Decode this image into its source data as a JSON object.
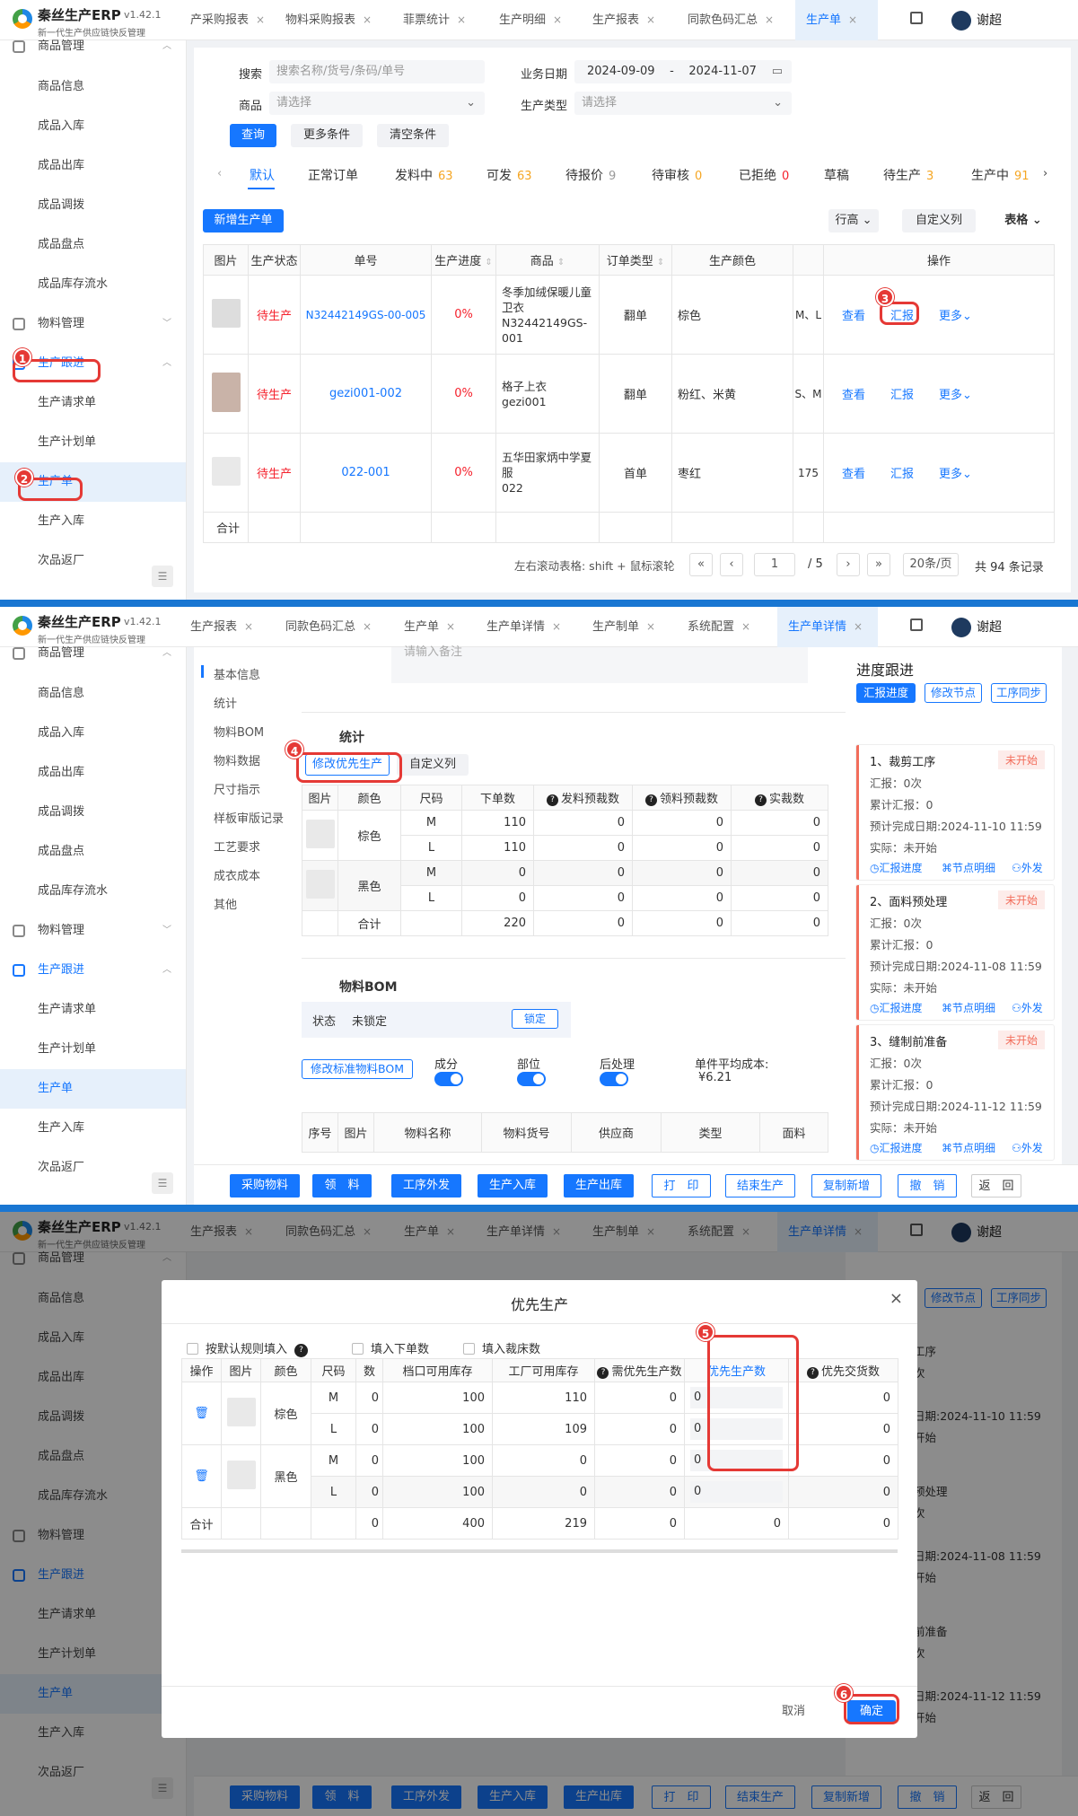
{
  "app": {
    "name": "秦丝生产ERP",
    "version": "v1.42.1",
    "subtitle": "新一代生产供应链快反管理",
    "user": "谢超"
  },
  "sidebar": {
    "g1": "商品管理",
    "s1": [
      "商品信息",
      "成品入库",
      "成品出库",
      "成品调拨",
      "成品盘点",
      "成品库存流水"
    ],
    "g2": "物料管理",
    "g3": "生产跟进",
    "s3": [
      "生产请求单",
      "生产计划单",
      "生产单",
      "生产入库",
      "次品返厂"
    ],
    "collapse": "☰"
  },
  "shot1": {
    "tabs": [
      "生产报表",
      "物料采购报表",
      "菲票统计",
      "生产明细",
      "生产报表",
      "同款色码汇总",
      "生产单"
    ],
    "tab0_prefix": "产采购报表",
    "search_label": "搜索",
    "search_ph": "搜索名称/货号/条码/单号",
    "date_label": "业务日期",
    "date_from": "2024-09-09",
    "date_to": "2024-11-07",
    "date_dash": "-",
    "goods_label": "商品",
    "goods_ph": "请选择",
    "type_label": "生产类型",
    "type_ph": "请选择",
    "query": "查询",
    "more": "更多条件",
    "clear": "清空条件",
    "status_tabs": [
      {
        "label": "默认",
        "count": ""
      },
      {
        "label": "正常订单",
        "count": ""
      },
      {
        "label": "发料中",
        "count": "63"
      },
      {
        "label": "可发",
        "count": "63"
      },
      {
        "label": "待报价",
        "count": "9"
      },
      {
        "label": "待审核",
        "count": "0"
      },
      {
        "label": "已拒绝",
        "count": "0"
      },
      {
        "label": "草稿",
        "count": ""
      },
      {
        "label": "待生产",
        "count": "3"
      },
      {
        "label": "生产中",
        "count": "91"
      }
    ],
    "new_btn": "新增生产单",
    "row_h": "行高",
    "custom_col": "自定义列",
    "table_mode": "表格",
    "cols": [
      "图片",
      "生产状态",
      "单号",
      "生产进度",
      "商品",
      "订单类型",
      "生产颜色",
      "",
      "操作"
    ],
    "rows": [
      {
        "status": "待生产",
        "no": "N32442149GS-00-005",
        "progress": "0%",
        "goods": "冬季加绒保暖儿童卫衣",
        "goods2": "N32442149GS-001",
        "otype": "翻单",
        "color": "棕色",
        "size": "M、L"
      },
      {
        "status": "待生产",
        "no": "gezi001-002",
        "progress": "0%",
        "goods": "格子上衣",
        "goods2": "gezi001",
        "otype": "翻单",
        "color": "粉红、米黄",
        "size": "S、M"
      },
      {
        "status": "待生产",
        "no": "022-001",
        "progress": "0%",
        "goods": "五华田家炳中学夏服",
        "goods2": "022",
        "otype": "首单",
        "color": "枣红",
        "size": "175"
      }
    ],
    "ops": {
      "view": "查看",
      "report": "汇报",
      "more": "更多"
    },
    "total_label": "合计",
    "scroll_hint": "左右滚动表格: shift + 鼠标滚轮",
    "page": "1",
    "pages": "/ 5",
    "per_page": "20条/页",
    "total": "共 94 条记录"
  },
  "shot2": {
    "tabs": [
      "生产报表",
      "同款色码汇总",
      "生产单",
      "生产单详情",
      "生产制单",
      "系统配置",
      "生产单详情"
    ],
    "anchors": [
      "基本信息",
      "统计",
      "物料BOM",
      "物料数据",
      "尺寸指示",
      "样板审版记录",
      "工艺要求",
      "成衣成本",
      "其他"
    ],
    "top_ph": "请输入备注",
    "stats_title": "统计",
    "edit_priority": "修改优先生产",
    "custom_col": "自定义列",
    "cols": [
      "图片",
      "颜色",
      "尺码",
      "下单数",
      "发料预裁数",
      "领料预裁数",
      "实裁数"
    ],
    "rows": [
      {
        "color": "棕色",
        "size": "M",
        "qty": "110",
        "a": "0",
        "b": "0",
        "c": "0"
      },
      {
        "color": "",
        "size": "L",
        "qty": "110",
        "a": "0",
        "b": "0",
        "c": "0"
      },
      {
        "color": "黑色",
        "size": "M",
        "qty": "0",
        "a": "0",
        "b": "0",
        "c": "0"
      },
      {
        "color": "",
        "size": "L",
        "qty": "0",
        "a": "0",
        "b": "0",
        "c": "0"
      }
    ],
    "sum": {
      "label": "合计",
      "qty": "220",
      "a": "0",
      "b": "0",
      "c": "0"
    },
    "bom_title": "物料BOM",
    "state_label": "状态",
    "state_val": "未锁定",
    "lock": "锁定",
    "edit_bom": "修改标准物料BOM",
    "sw1": "成分",
    "sw2": "部位",
    "sw3": "后处理",
    "avg_cost_label": "单件平均成本:",
    "avg_cost": "¥6.21",
    "bom_cols": [
      "序号",
      "图片",
      "物料名称",
      "物料货号",
      "供应商",
      "类型",
      "面料"
    ],
    "progress_title": "进度跟进",
    "report_prog": "汇报进度",
    "edit_node": "修改节点",
    "sync": "工序同步",
    "cards": [
      {
        "title": "1、裁剪工序",
        "status": "未开始",
        "report": "汇报：0次",
        "acc": "累计汇报：0",
        "plan": "预计完成日期:2024-11-10 11:59",
        "actual": "实际：未开始"
      },
      {
        "title": "2、面料预处理",
        "status": "未开始",
        "report": "汇报：0次",
        "acc": "累计汇报：0",
        "plan": "预计完成日期:2024-11-08 11:59",
        "actual": "实际：未开始"
      },
      {
        "title": "3、缝制前准备",
        "status": "未开始",
        "report": "汇报：0次",
        "acc": "累计汇报：0",
        "plan": "预计完成日期:2024-11-12 11:59",
        "actual": "实际：未开始"
      }
    ],
    "card_links": [
      "汇报进度",
      "节点明细",
      "外发"
    ],
    "bottom": [
      "采购物料",
      "领　料",
      "工序外发",
      "生产入库",
      "生产出库",
      "打　印",
      "结束生产",
      "复制新增",
      "撤　销",
      "返　回"
    ]
  },
  "shot3": {
    "modal_title": "优先生产",
    "opt1": "按默认规则填入",
    "opt2": "填入下单数",
    "opt3": "填入裁床数",
    "cols": [
      "操作",
      "图片",
      "颜色",
      "尺码",
      "数",
      "档口可用库存",
      "工厂可用库存",
      "需优先生产数",
      "优先生产数",
      "优先交货数"
    ],
    "rows": [
      {
        "color": "棕色",
        "size": "M",
        "n": "0",
        "shop": "100",
        "factory": "110",
        "need": "0",
        "prio": "0",
        "deliv": "0"
      },
      {
        "color": "",
        "size": "L",
        "n": "0",
        "shop": "100",
        "factory": "109",
        "need": "0",
        "prio": "0",
        "deliv": "0"
      },
      {
        "color": "黑色",
        "size": "M",
        "n": "0",
        "shop": "100",
        "factory": "0",
        "need": "0",
        "prio": "0",
        "deliv": "0"
      },
      {
        "color": "",
        "size": "L",
        "n": "0",
        "shop": "100",
        "factory": "0",
        "need": "0",
        "prio": "0",
        "deliv": "0"
      }
    ],
    "sum": {
      "label": "合计",
      "n": "0",
      "shop": "400",
      "factory": "219",
      "need": "0",
      "prio": "0",
      "deliv": "0"
    },
    "cancel": "取消",
    "ok": "确定",
    "close": "×",
    "bg_tail": [
      "工序",
      "次",
      "日期:2024-11-10 11:59",
      "开始",
      "预处理",
      "次",
      "日期:2024-11-08 11:59",
      "开始",
      "前准备",
      "次",
      "日期:2024-11-12 11:59",
      "开始"
    ]
  },
  "annotations": [
    "1",
    "2",
    "3",
    "4",
    "5",
    "6"
  ]
}
